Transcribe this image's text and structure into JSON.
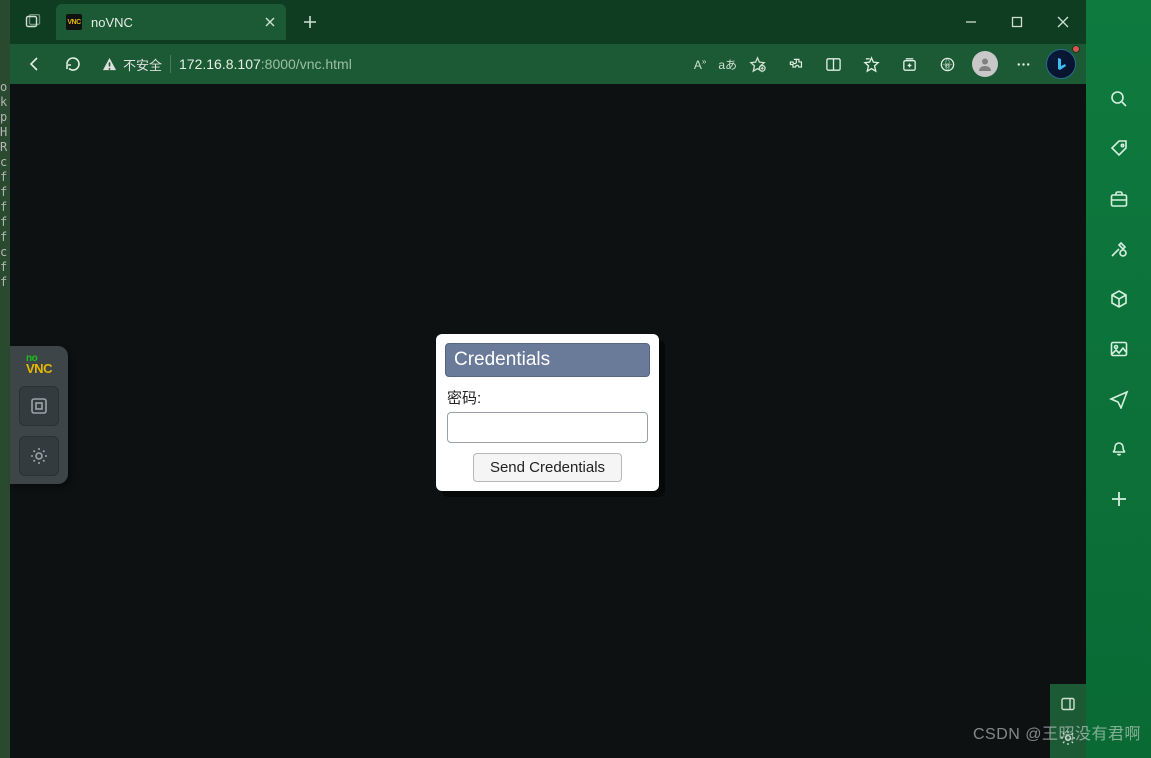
{
  "browser": {
    "tab_title": "noVNC",
    "security_label": "不安全",
    "url_host": "172.16.8.107",
    "url_rest": ":8000/vnc.html"
  },
  "novnc": {
    "logo_top": "no",
    "logo_bot": "VNC"
  },
  "dialog": {
    "title": "Credentials",
    "password_label": "密码:",
    "submit_label": "Send Credentials"
  },
  "left_letters": "o\nk\np\nH\nR\nc\nf\nf\nf\nf\nf\nc\nf\nf",
  "watermark": "CSDN @王昭没有君啊"
}
